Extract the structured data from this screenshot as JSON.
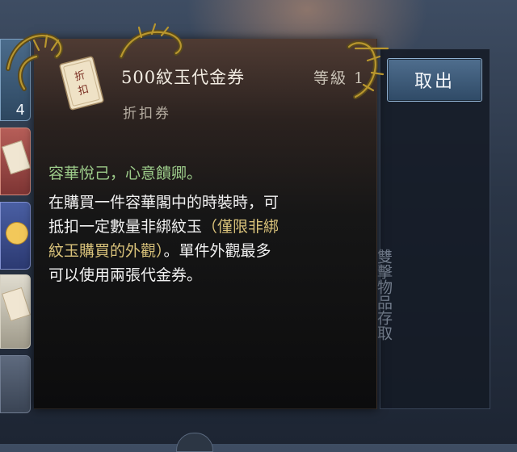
{
  "item": {
    "title": "500紋玉代金券",
    "level": "等級 1",
    "type": "折扣券",
    "icon_label": "折扣"
  },
  "description": {
    "flavor": "容華悅己，心意饋卿。",
    "line1": "在購買一件容華閣中的時裝時，可",
    "line2_main": "抵扣一定數量非綁紋玉",
    "line2_gold": "（僅限非綁",
    "line3_gold": "紋玉購買的外觀）",
    "line3_main": "。單件外觀最多",
    "line4": "可以使用兩張代金券。"
  },
  "actions": {
    "cancel_label": "取出"
  },
  "side_panel": {
    "vertical_label": "雙擊物品存取"
  },
  "inventory": {
    "slot_1_qty": "4"
  },
  "colors": {
    "flavor_text": "#9dcc8a",
    "highlight_text": "#d9c27a",
    "cancel_button": "#3f5c7a"
  }
}
